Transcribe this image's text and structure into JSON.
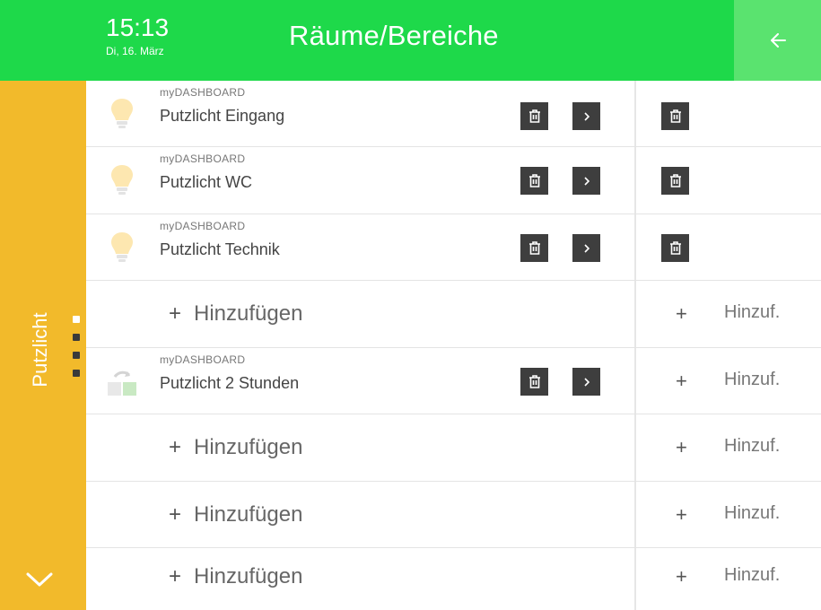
{
  "header": {
    "time": "15:13",
    "date": "Di, 16. März",
    "title": "Räume/Bereiche",
    "back_icon": "arrow-left-icon",
    "color": "#1ed94a"
  },
  "sidebar": {
    "group_label": "Putzlicht",
    "color": "#f2ba2b",
    "page_dots": 4,
    "active_dot": 1
  },
  "rows": [
    {
      "type": "item",
      "source": "myDASHBOARD",
      "name": "Putzlicht Eingang",
      "icon": "light-bulb-icon"
    },
    {
      "type": "item",
      "source": "myDASHBOARD",
      "name": "Putzlicht WC",
      "icon": "light-bulb-icon"
    },
    {
      "type": "item",
      "source": "myDASHBOARD",
      "name": "Putzlicht Technik",
      "icon": "light-bulb-icon"
    },
    {
      "type": "add",
      "label": "Hinzufügen",
      "side_label": "Hinzuf."
    },
    {
      "type": "scene",
      "source": "myDASHBOARD",
      "name": "Putzlicht 2 Stunden",
      "icon": "scene-icon",
      "side_label": "Hinzuf."
    },
    {
      "type": "add",
      "label": "Hinzufügen",
      "side_label": "Hinzuf."
    },
    {
      "type": "add",
      "label": "Hinzufügen",
      "side_label": "Hinzuf."
    },
    {
      "type": "add",
      "label": "Hinzufügen",
      "side_label": "Hinzuf."
    }
  ],
  "add_symbol": "+"
}
